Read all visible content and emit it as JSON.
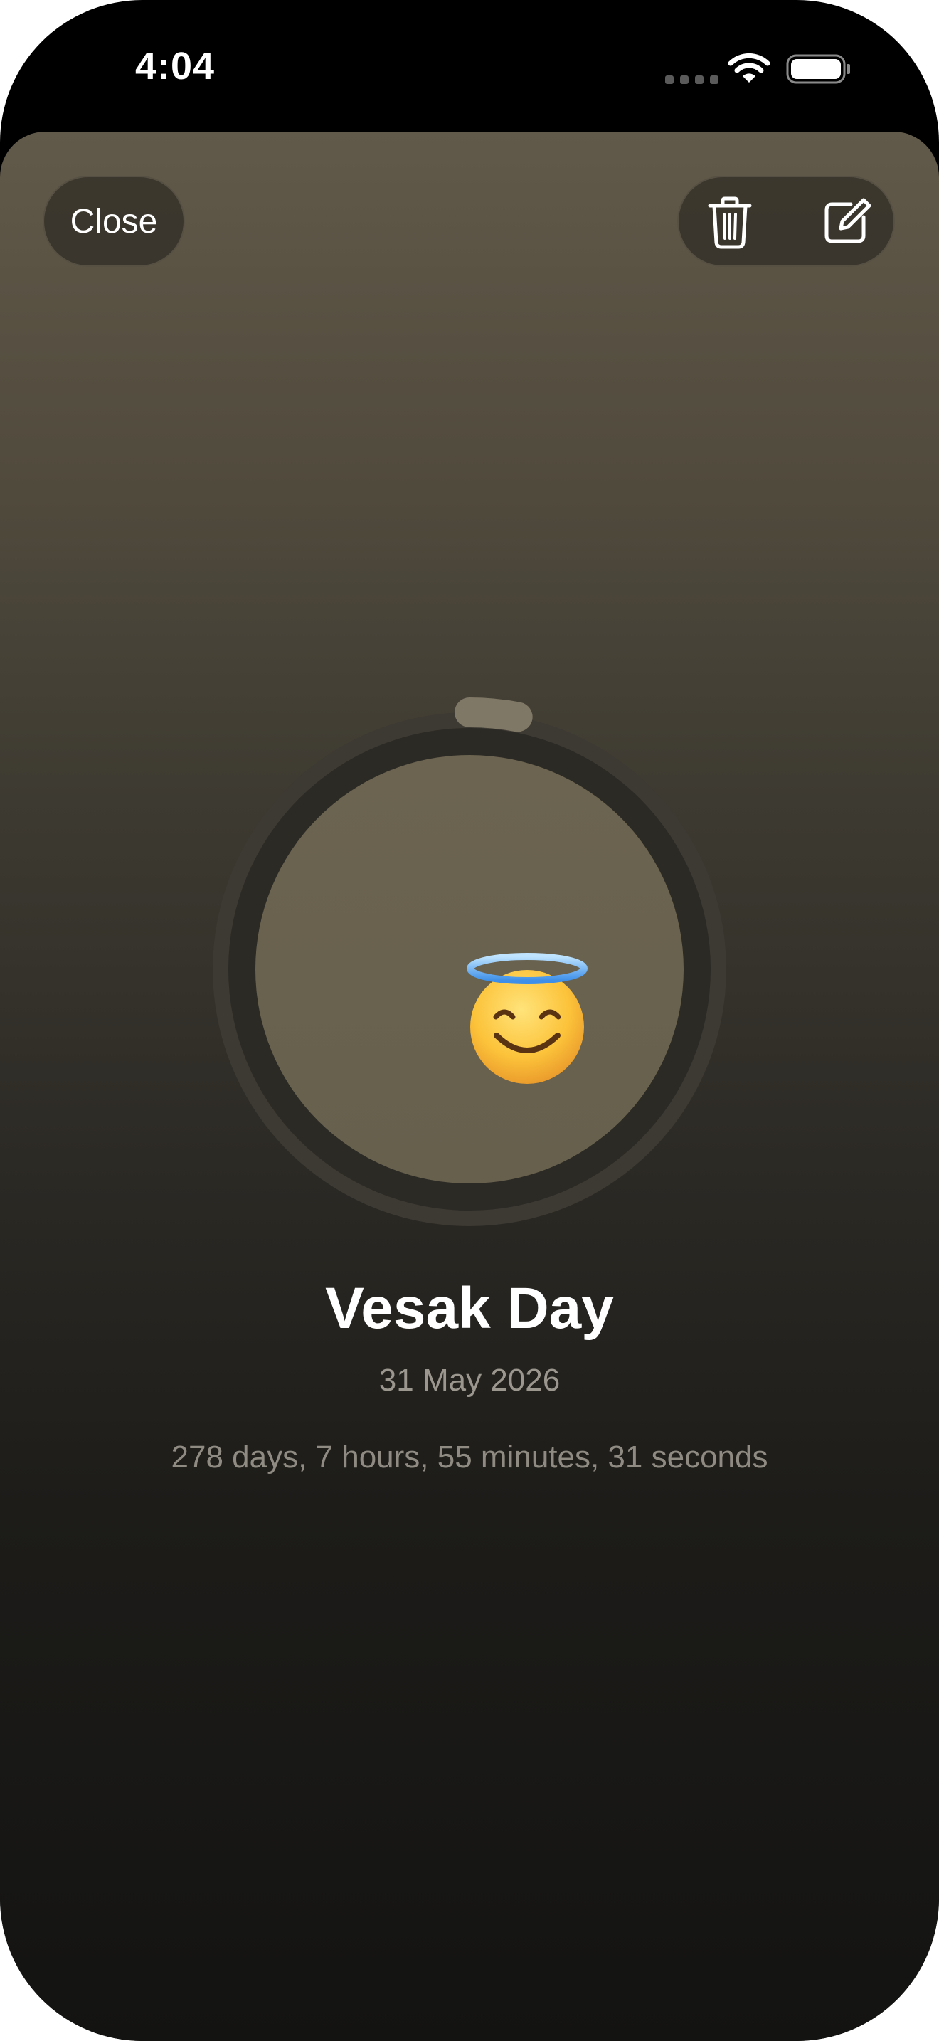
{
  "status_bar": {
    "time": "4:04"
  },
  "toolbar": {
    "close_label": "Close",
    "delete_icon": "trash-icon",
    "edit_icon": "square-and-pencil-icon"
  },
  "event": {
    "emoji": "smiling-face-with-halo",
    "title": "Vesak Day",
    "date": "31 May 2026",
    "countdown": "278 days, 7 hours, 55 minutes, 31 seconds",
    "progress_fraction": 0.03
  },
  "colors": {
    "background_top": "#615949",
    "background_bottom": "#131312",
    "ring_track": "#45403a",
    "ring_progress": "#807866",
    "disc": "#6a6250",
    "text_primary": "#ffffff",
    "text_secondary": "#9b978e"
  }
}
